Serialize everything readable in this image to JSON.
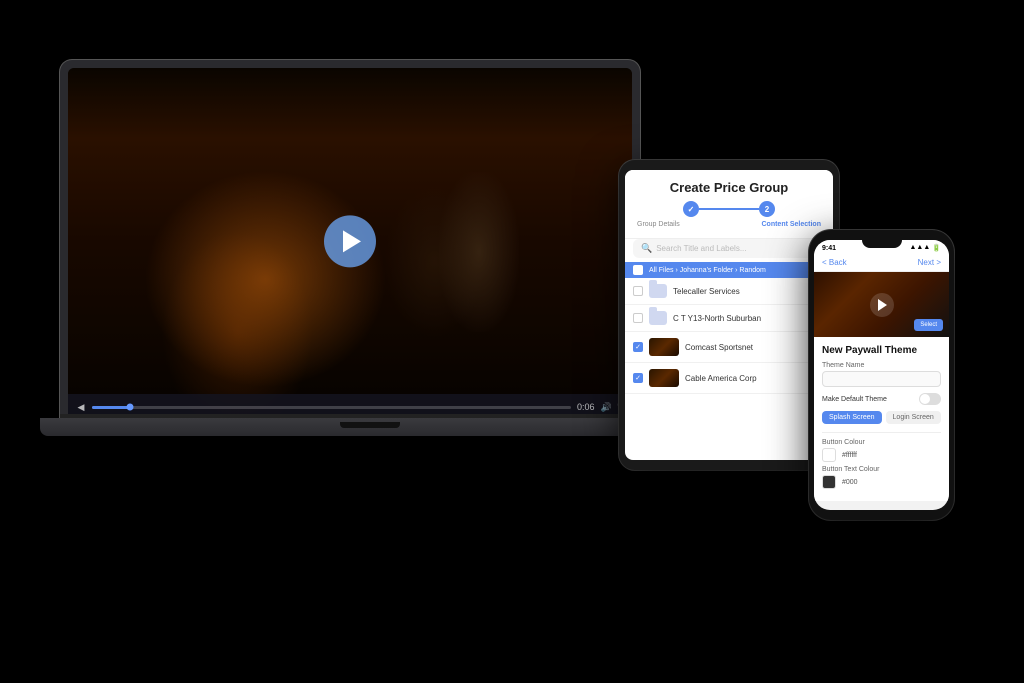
{
  "background_color": "#000000",
  "laptop": {
    "video": {
      "play_button_visible": true,
      "time_current": "0:06",
      "time_total": "0:06",
      "progress_percent": 8
    }
  },
  "tablet": {
    "title": "Create Price Group",
    "steps": [
      {
        "label": "Group Details",
        "number": "1",
        "state": "done"
      },
      {
        "label": "Content Selection",
        "number": "2",
        "state": "active"
      }
    ],
    "search_placeholder": "Search Title and Labels...",
    "breadcrumb": "All Files › Johanna's Folder › Random",
    "file_items": [
      {
        "name": "Telecaller Services",
        "type": "folder",
        "checked": false
      },
      {
        "name": "C T Y13-North Suburban",
        "type": "folder",
        "checked": false
      },
      {
        "name": "Comcast Sportsnet",
        "type": "video",
        "checked": true
      },
      {
        "name": "Cable America Corp",
        "type": "video",
        "checked": true
      }
    ]
  },
  "phone": {
    "status_bar": {
      "time": "9:41",
      "battery": "●●●",
      "signal": "●●●"
    },
    "nav": {
      "back_label": "< Back",
      "next_label": "Next >"
    },
    "video_section": {
      "play_button_visible": true,
      "blue_btn_label": "Select"
    },
    "paywall_theme": {
      "section_title": "New Paywall Theme",
      "theme_name_label": "Theme Name",
      "theme_name_placeholder": "",
      "default_theme_label": "Make Default Theme",
      "splash_screen_tab": "Splash Screen",
      "login_screen_tab": "Login Screen",
      "button_colour_label": "Button Colour",
      "button_colour_value": "#ffffff",
      "button_text_colour_label": "Button Text Colour",
      "button_text_colour_value": "#000"
    }
  }
}
